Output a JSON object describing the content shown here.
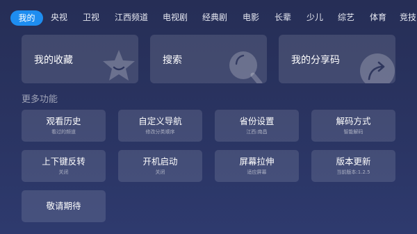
{
  "nav": {
    "items": [
      "我的",
      "央视",
      "卫视",
      "江西频道",
      "电视剧",
      "经典剧",
      "电影",
      "长辈",
      "少儿",
      "综艺",
      "体育",
      "竞技"
    ],
    "active_index": 0,
    "accent_color": "#1e8df0"
  },
  "big_cards": [
    {
      "label": "我的收藏",
      "icon": "star-icon"
    },
    {
      "label": "搜索",
      "icon": "search-icon"
    },
    {
      "label": "我的分享码",
      "icon": "share-icon"
    }
  ],
  "section_title": "更多功能",
  "functions": [
    {
      "title": "观看历史",
      "subtitle": "看过的频道"
    },
    {
      "title": "自定义导航",
      "subtitle": "修改分类顺序"
    },
    {
      "title": "省份设置",
      "subtitle": "江西:南昌"
    },
    {
      "title": "解码方式",
      "subtitle": "智能解码"
    },
    {
      "title": "上下键反转",
      "subtitle": "关闭"
    },
    {
      "title": "开机启动",
      "subtitle": "关闭"
    },
    {
      "title": "屏幕拉伸",
      "subtitle": "适应屏幕"
    },
    {
      "title": "版本更新",
      "subtitle": "当前版本:1.2.5"
    },
    {
      "title": "敬请期待",
      "subtitle": ""
    }
  ]
}
